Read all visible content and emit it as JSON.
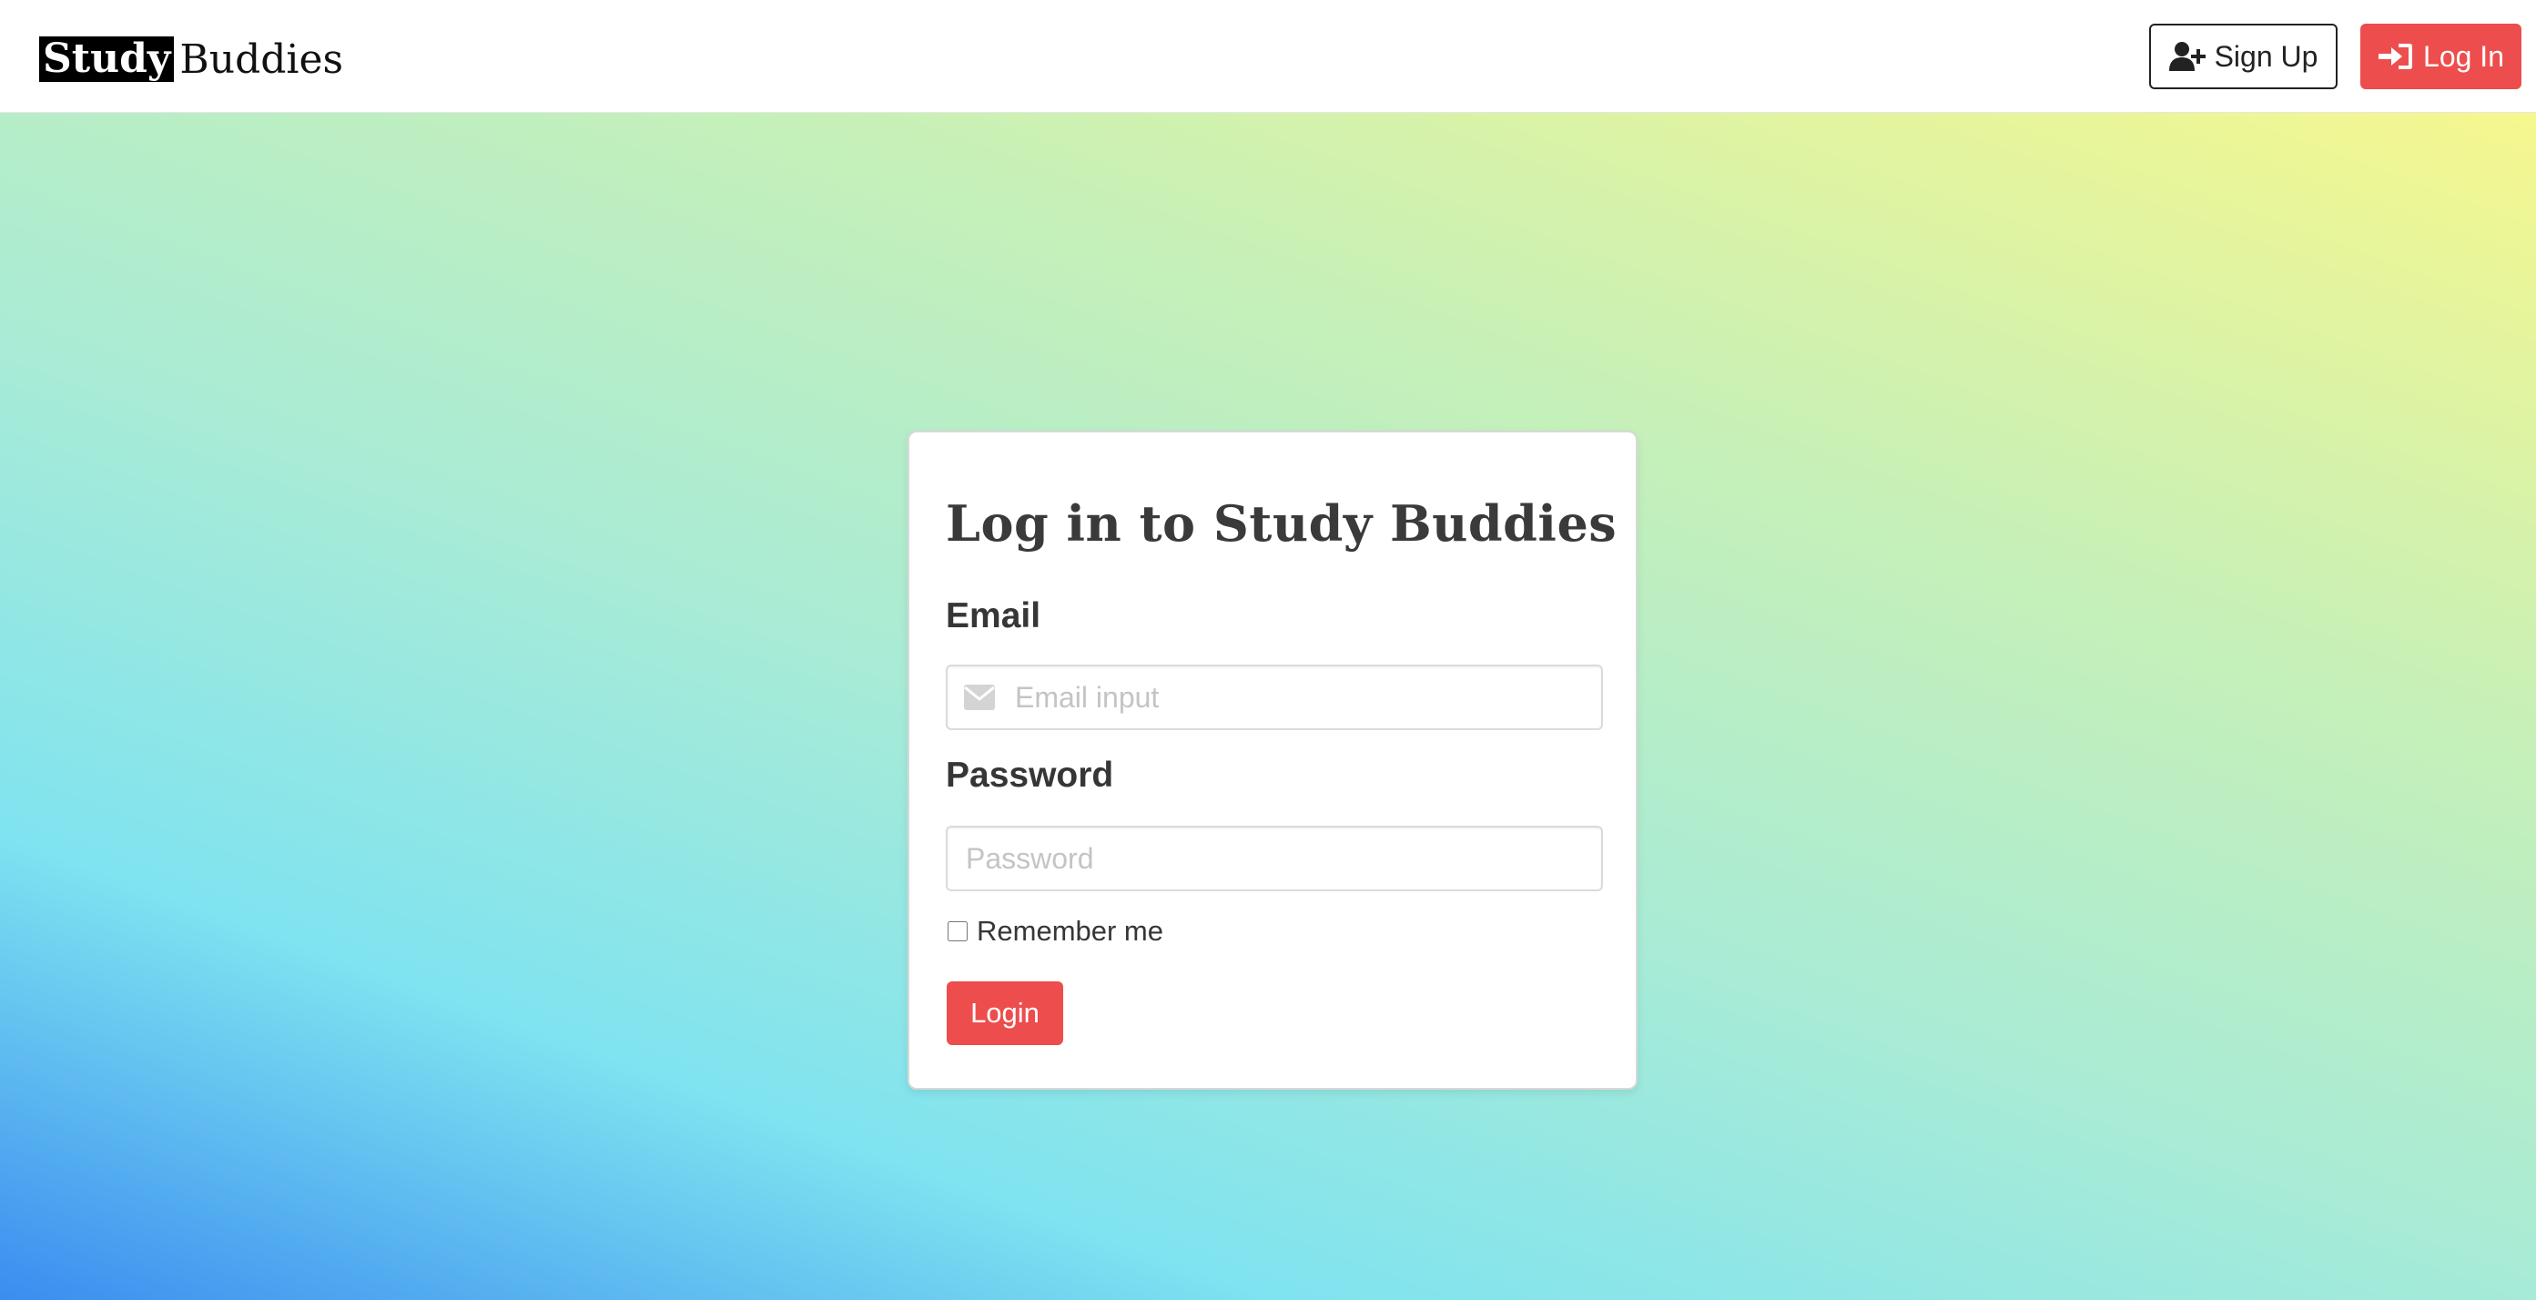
{
  "navbar": {
    "brand": {
      "highlight": "Study",
      "rest": "Buddies"
    },
    "signup_label": "Sign Up",
    "signup_icon": "user-plus-icon",
    "login_label": "Log In",
    "login_icon": "sign-in-icon"
  },
  "login_card": {
    "title": "Log in to Study Buddies",
    "email_label": "Email",
    "email_placeholder": "Email input",
    "email_icon": "envelope-icon",
    "password_label": "Password",
    "password_placeholder": "Password",
    "remember_label": "Remember me",
    "remember_checked": false,
    "submit_label": "Login"
  },
  "colors": {
    "accent": "#ed4d4d",
    "gradient": [
      "#3a8df0",
      "#7fe3f0",
      "#a8ebd6",
      "#c6f0b8",
      "#f6f78e"
    ]
  }
}
